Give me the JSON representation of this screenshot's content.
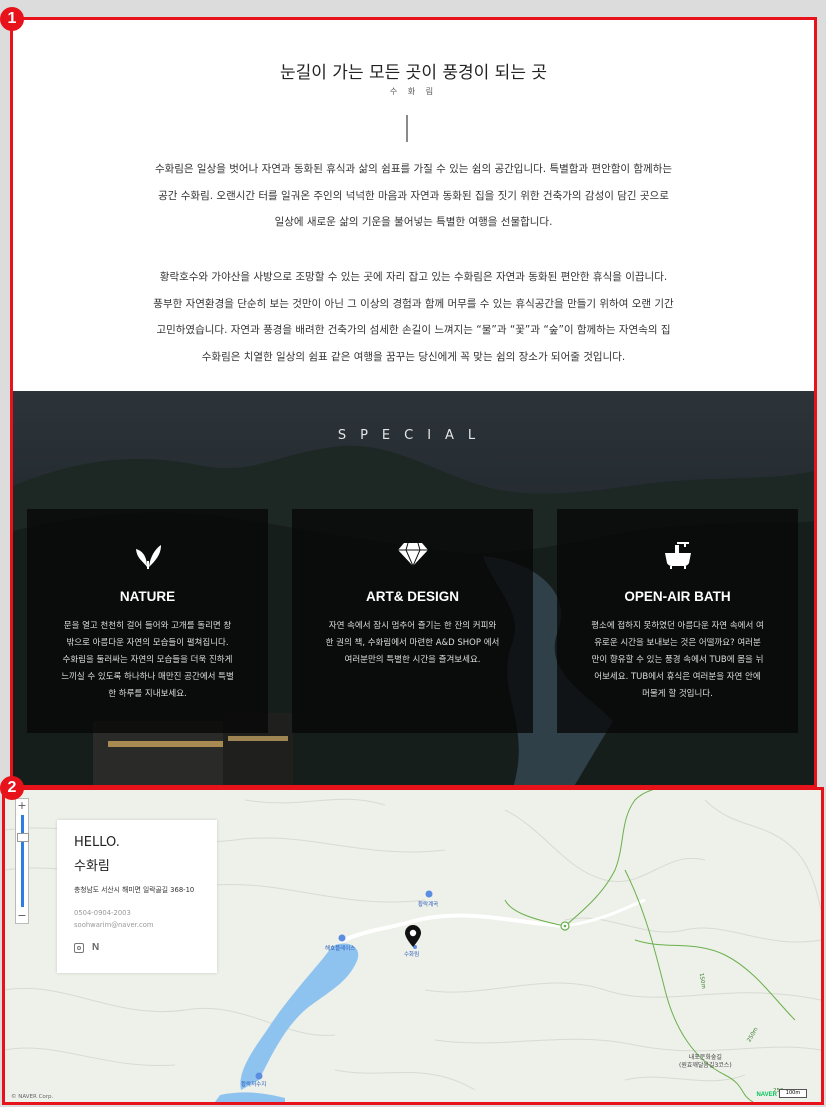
{
  "badges": [
    "1",
    "2"
  ],
  "intro": {
    "title": "눈길이 가는 모든 곳이 풍경이 되는 곳",
    "subtitle": "수 화 림",
    "para1": [
      "수화림은 일상을 벗어나 자연과 동화된 휴식과 삶의 쉼표를 가질 수 있는 쉼의 공간입니다. 특별함과 편안함이 함께하는",
      "공간 수화림. 오랜시간 터를 일궈온 주인의 넉넉한 마음과 자연과 동화된 집을 짓기 위한 건축가의 감성이 담긴 곳으로",
      "일상에 새로운 삶의 기운을 불어넣는 특별한 여행을 선물합니다."
    ],
    "para2": [
      "황락호수와 가야산을 사방으로 조망할 수 있는 곳에 자리 잡고 있는 수화림은 자연과 동화된 편안한 휴식을 이끕니다.",
      "풍부한 자연환경을 단순히 보는 것만이 아닌 그 이상의 경험과 함께 머무를 수 있는 휴식공간을 만들기 위하여 오랜 기간",
      "고민하였습니다. 자연과 풍경을 배려한 건축가의 섬세한 손길이 느껴지는 “물”과 “꽃”과 “숲”이 함께하는 자연속의 집",
      "수화림은 치열한 일상의 쉼표 같은 여행을 꿈꾸는 당신에게 꼭 맞는 쉼의 장소가 되어줄 것입니다."
    ]
  },
  "special": {
    "title": "SPECIAL",
    "cards": [
      {
        "icon": "leaf-icon",
        "heading": "NATURE",
        "desc": [
          "문을 열고 천천히 걸어 들어와 고개를 돌리면 창",
          "밖으로 아름다운 자연의 모습들이 펼쳐집니다.",
          "수화림을 둘러싸는 자연의 모습들을 더욱 진하게",
          "느끼실 수 있도록 하나하나 매만진 공간에서 특별",
          "한 하루를 지내보세요."
        ]
      },
      {
        "icon": "diamond-icon",
        "heading": "ART& DESIGN",
        "desc": [
          "자연 속에서 잠시 멈추어 즐기는 한 잔의 커피와",
          "한 권의 책, 수화림에서 마련한 A&D SHOP 에서",
          "여러분만의 특별한 시간을 즐겨보세요."
        ]
      },
      {
        "icon": "bathtub-icon",
        "heading": "OPEN-AIR BATH",
        "desc": [
          "평소에 접하지 못하였던 아름다운 자연 속에서 여",
          "유로운 시간을 보내보는 것은 어떨까요? 여러분",
          "만이 향유할 수 있는 풍경 속에서 TUB에 몸을 뉘",
          "어보세요. TUB에서 휴식은 여러분을 자연 안에",
          "머물게 할 것입니다."
        ]
      }
    ]
  },
  "map": {
    "zoom_plus": "+",
    "zoom_minus": "−",
    "hello": "HELLO.",
    "name": "수화림",
    "address": "충청남도 서산시 해미면 일락골길 368-10",
    "phone": "0504-0904-2003",
    "email": "soohwarim@naver.com",
    "sns_n": "N",
    "labels": {
      "place1": "황락계곡",
      "place2": "해호플레이스",
      "pin": "수화림",
      "place3": "황락저수지",
      "trail": "내포문화숲길\n(원효깨달음길3코스)",
      "dist1": "150m",
      "dist2": "250m",
      "dist3": "250m"
    },
    "copyright": "© NAVER Corp.",
    "naver": "NAVER",
    "scale": "100m"
  },
  "colors": {
    "frame": "#e8121b",
    "water": "#8fc3ef",
    "trail": "#6ab04c"
  }
}
